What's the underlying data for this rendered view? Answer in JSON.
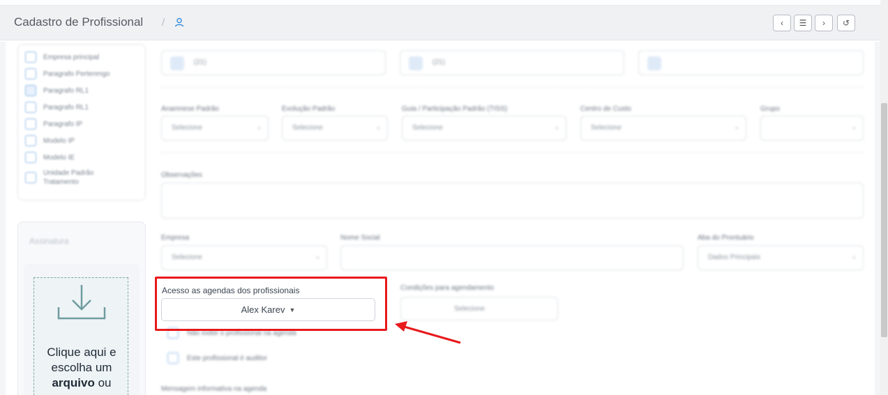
{
  "header": {
    "title": "Cadastro de Profissional",
    "separator": "/",
    "nav": {
      "prev": "‹",
      "list": "☰",
      "next": "›",
      "history": "↺"
    }
  },
  "sidebar": {
    "checkbox_items": [
      {
        "label": "Empresa principal",
        "checked": false
      },
      {
        "label": "Paragrafo Pertenmgo",
        "checked": false
      },
      {
        "label": "Paragrafo RL1",
        "checked": true
      },
      {
        "label": "Paragrafo RL1",
        "checked": false
      },
      {
        "label": "Paragrafo IP",
        "checked": false
      },
      {
        "label": "Modelo IP",
        "checked": false
      },
      {
        "label": "Modelo IE",
        "checked": false
      },
      {
        "label": "Unidade Padrão Tratamento",
        "checked": false
      }
    ],
    "assinatura_label": "Assinatura",
    "upload_text": {
      "part1": "Clique aqui e escolha um ",
      "bold": "arquivo",
      "part2": " ou"
    }
  },
  "form": {
    "phones": [
      "(21)",
      "(21)",
      ""
    ],
    "selects_row": [
      {
        "label": "Anamnese Padrão",
        "value": "Selecione"
      },
      {
        "label": "Evolução Padrão",
        "value": "Selecione"
      },
      {
        "label": "Guia / Participação Padrão (TISS)",
        "value": "Selecione"
      },
      {
        "label": "Centro de Custo",
        "value": "Selecione"
      },
      {
        "label": "Grupo",
        "value": ""
      }
    ],
    "observacoes_label": "Observações",
    "empresa": {
      "label": "Empresa",
      "value": "Selecione"
    },
    "nome_social": {
      "label": "Nome Social",
      "value": ""
    },
    "aba_prontuario": {
      "label": "Aba do Prontuário",
      "value": "Dados Principais"
    },
    "agenda_access": {
      "label": "Acesso as agendas dos profissionais",
      "value": "Alex Karev"
    },
    "condicoes": {
      "label": "Condições para agendamento",
      "value": "Selecione"
    },
    "checks": [
      "Não exibir o profissional na agenda",
      "Este profissional é auditor"
    ],
    "mensagem_label": "Mensagem informativa na agenda"
  },
  "colors": {
    "highlight": "#e8191c",
    "accent": "#3b8fe0"
  }
}
